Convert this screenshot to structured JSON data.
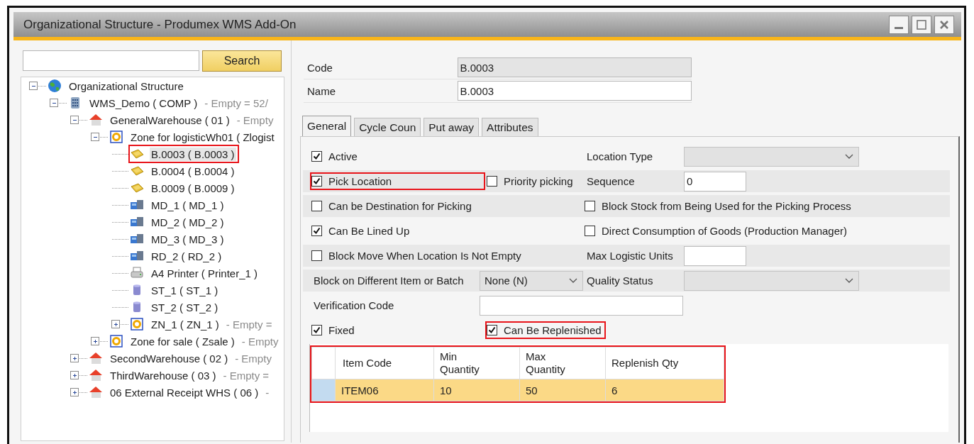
{
  "window": {
    "title": "Organizational Structure - Produmex WMS Add-On"
  },
  "search": {
    "button": "Search"
  },
  "tree": [
    {
      "label": "Organizational Structure",
      "kind": "globe",
      "expanded": true,
      "selected": false,
      "highlighted": false,
      "children": [
        {
          "label": "WMS_Demo ( COMP )",
          "note": "- Empty = 52/",
          "kind": "database",
          "expanded": true,
          "selected": false,
          "highlighted": false,
          "children": [
            {
              "label": "GeneralWarehouse ( 01 )",
              "note": "- Empty",
              "kind": "warehouse",
              "expanded": true,
              "selected": false,
              "highlighted": false,
              "children": [
                {
                  "label": "Zone for logisticWh01 ( Zlogist",
                  "kind": "zone",
                  "expanded": true,
                  "selected": false,
                  "highlighted": false,
                  "children": [
                    {
                      "label": "B.0003 ( B.0003 )",
                      "kind": "bin",
                      "selected": true,
                      "highlighted": true
                    },
                    {
                      "label": "B.0004 ( B.0004 )",
                      "kind": "bin",
                      "selected": false,
                      "highlighted": false
                    },
                    {
                      "label": "B.0009 ( B.0009 )",
                      "kind": "bin",
                      "selected": false,
                      "highlighted": false
                    },
                    {
                      "label": "MD_1 ( MD_1 )",
                      "kind": "machine",
                      "selected": false,
                      "highlighted": false
                    },
                    {
                      "label": "MD_2 ( MD_2 )",
                      "kind": "machine",
                      "selected": false,
                      "highlighted": false
                    },
                    {
                      "label": "MD_3 ( MD_3 )",
                      "kind": "machine",
                      "selected": false,
                      "highlighted": false
                    },
                    {
                      "label": "RD_2 ( RD_2 )",
                      "kind": "machine",
                      "selected": false,
                      "highlighted": false
                    },
                    {
                      "label": "A4 Printer ( Printer_1 )",
                      "kind": "printer",
                      "selected": false,
                      "highlighted": false
                    },
                    {
                      "label": "ST_1 ( ST_1 )",
                      "kind": "storage",
                      "selected": false,
                      "highlighted": false
                    },
                    {
                      "label": "ST_2 ( ST_2 )",
                      "kind": "storage",
                      "selected": false,
                      "highlighted": false
                    },
                    {
                      "label": "ZN_1 ( ZN_1 )",
                      "note": "- Empty =",
                      "kind": "zone",
                      "expanded": false,
                      "selected": false,
                      "highlighted": false
                    }
                  ]
                },
                {
                  "label": "Zone for sale ( Zsale )",
                  "note": "- Empty",
                  "kind": "zone",
                  "expanded": false,
                  "selected": false,
                  "highlighted": false
                }
              ]
            },
            {
              "label": "SecondWarehouse ( 02 )",
              "note": "- Empty",
              "kind": "warehouse",
              "expanded": false,
              "selected": false,
              "highlighted": false
            },
            {
              "label": "ThirdWarehouse ( 03 )",
              "note": "- Empty =",
              "kind": "warehouse",
              "expanded": false,
              "selected": false,
              "highlighted": false
            },
            {
              "label": "06 External Receipt WHS ( 06 )",
              "note": "-",
              "kind": "warehouse",
              "expanded": false,
              "selected": false,
              "highlighted": false
            }
          ]
        }
      ]
    }
  ],
  "header_fields": [
    {
      "label": "Code",
      "value": "B.0003",
      "disabled": true
    },
    {
      "label": "Name",
      "value": "B.0003",
      "disabled": false
    }
  ],
  "tabs": [
    {
      "label": "General",
      "selected": true
    },
    {
      "label": "Cycle Coun",
      "selected": false
    },
    {
      "label": "Put away",
      "selected": false
    },
    {
      "label": "Attributes",
      "selected": false
    }
  ],
  "form_rows": [
    {
      "shaded": false,
      "left": [
        {
          "kind": "checkbox",
          "label": "Active",
          "checked": true,
          "highlighted": false
        }
      ],
      "right": [
        {
          "kind": "label",
          "text": "Location Type"
        },
        {
          "kind": "dropdown"
        }
      ]
    },
    {
      "shaded": true,
      "left": [
        {
          "kind": "checkbox",
          "label": "Pick Location",
          "checked": true,
          "highlighted": true
        },
        {
          "kind": "checkbox",
          "label": "Priority picking",
          "checked": false,
          "highlighted": false
        }
      ],
      "right": [
        {
          "kind": "label",
          "text": "Sequence"
        },
        {
          "kind": "input",
          "value": "0"
        }
      ]
    },
    {
      "shaded": true,
      "left": [
        {
          "kind": "checkbox",
          "label": "Can be Destination for Picking",
          "checked": false,
          "highlighted": false
        }
      ],
      "right": [
        {
          "kind": "checkbox",
          "label": "Block Stock from Being Used for the Picking Process",
          "checked": false,
          "highlighted": false
        }
      ]
    },
    {
      "shaded": false,
      "left": [
        {
          "kind": "checkbox",
          "label": "Can Be Lined Up",
          "checked": true,
          "highlighted": false
        }
      ],
      "right": [
        {
          "kind": "checkbox",
          "label": "Direct Consumption of Goods (Production Manager)",
          "checked": false,
          "highlighted": false
        }
      ]
    },
    {
      "shaded": true,
      "left": [
        {
          "kind": "checkbox",
          "label": "Block Move When Location Is Not Empty",
          "checked": false,
          "highlighted": false
        }
      ],
      "right": [
        {
          "kind": "label",
          "text": "Max Logistic Units"
        },
        {
          "kind": "input"
        }
      ]
    },
    {
      "shaded": true,
      "left": [
        {
          "kind": "label",
          "text": "Block on Different Item or Batch"
        },
        {
          "kind": "dropdown",
          "value": "None (N)"
        }
      ],
      "right": [
        {
          "kind": "label",
          "text": "Quality Status"
        },
        {
          "kind": "dropdown"
        }
      ]
    },
    {
      "shaded": false,
      "left": [
        {
          "kind": "label",
          "text": "Verification Code"
        },
        {
          "kind": "input"
        }
      ]
    },
    {
      "shaded": false,
      "left": [
        {
          "kind": "checkbox",
          "label": "Fixed",
          "checked": true,
          "highlighted": false
        },
        {
          "kind": "checkbox",
          "label": "Can Be Replenished",
          "checked": true,
          "highlighted": true
        }
      ]
    }
  ],
  "grid": {
    "highlighted": true,
    "columns": [
      "Item Code",
      "Min\nQuantity",
      "Max\nQuantity",
      "Replenish Qty"
    ],
    "rows": [
      {
        "selected": true,
        "cells": [
          "ITEM06",
          "10",
          "50",
          "6"
        ]
      }
    ]
  }
}
